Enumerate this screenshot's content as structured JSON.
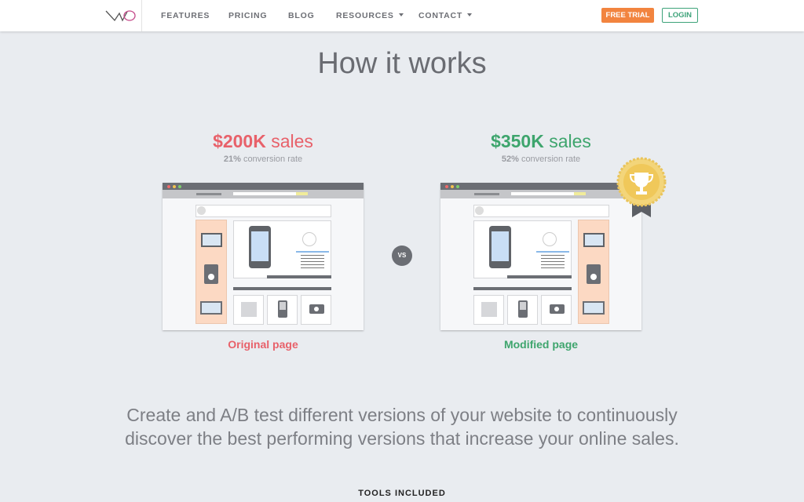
{
  "nav": {
    "logo": "VWO",
    "items": [
      {
        "label": "FEATURES"
      },
      {
        "label": "PRICING"
      },
      {
        "label": "BLOG"
      },
      {
        "label": "RESOURCES",
        "dropdown": true
      },
      {
        "label": "CONTACT",
        "dropdown": true
      }
    ],
    "free_trial": "FREE TRIAL",
    "login": "LOGIN"
  },
  "title": "How it works",
  "original": {
    "amount": "$200K",
    "sales_word": "sales",
    "conv_pct": "21%",
    "conv_text": "conversion rate",
    "caption": "Original page",
    "color": "#e8616a"
  },
  "modified": {
    "amount": "$350K",
    "sales_word": "sales",
    "conv_pct": "52%",
    "conv_text": "conversion rate",
    "caption": "Modified page",
    "color": "#3ea56d"
  },
  "vs": "VS",
  "description": "Create and A/B test different versions of your website to continuously discover the best performing versions that increase your online sales.",
  "tools_heading": "TOOLS INCLUDED",
  "colors": {
    "accent_orange": "#f2843f",
    "accent_green": "#3ea37a",
    "sidebar_peach": "#fcd9c3"
  }
}
